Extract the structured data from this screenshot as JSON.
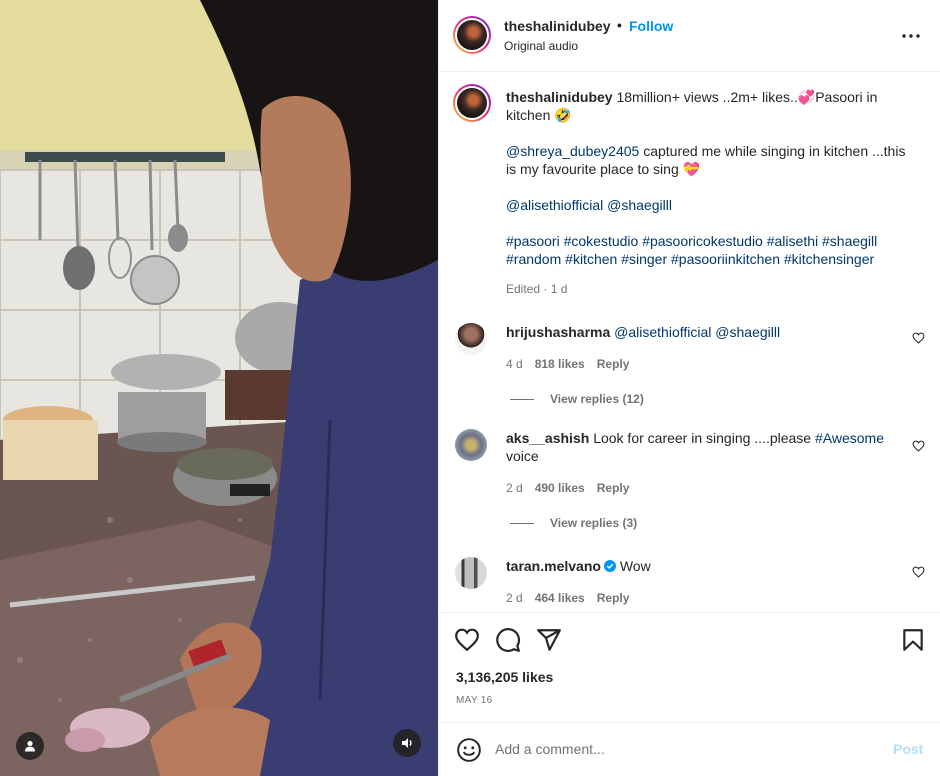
{
  "header": {
    "username": "theshalinidubey",
    "separator": "•",
    "follow_label": "Follow",
    "audio_label": "Original audio"
  },
  "caption": {
    "username": "theshalinidubey",
    "line1": "18million+ views ..2m+ likes..💞Pasoori in kitchen 🤣",
    "p2_mention": "@shreya_dubey2405",
    "p2_text": "captured me while singing in kitchen ...this is my favourite place to sing 💝",
    "p3_mention1": "@alisethiofficial",
    "p3_mention2": "@shaegilll",
    "hashtags": [
      "#pasoori",
      "#cokestudio",
      "#pasooricokestudio",
      "#alisethi",
      "#shaegill",
      "#random",
      "#kitchen",
      "#singer",
      "#pasooriinkitchen",
      "#kitchensinger"
    ],
    "meta": "Edited · 1 d"
  },
  "comments": [
    {
      "username": "hrijushasharma",
      "text_mention1": "@alisethiofficial",
      "text_mention2": "@shaegilll",
      "time": "4 d",
      "likes": "818 likes",
      "reply": "Reply",
      "view_replies": "View replies (12)"
    },
    {
      "username": "aks__ashish",
      "text": "Look for career in singing ....please",
      "text_tag": "#Awesome",
      "text_end": "voice",
      "time": "2 d",
      "likes": "490 likes",
      "reply": "Reply",
      "view_replies": "View replies (3)"
    },
    {
      "username": "taran.melvano",
      "verified": true,
      "text": "Wow",
      "time": "2 d",
      "likes": "464 likes",
      "reply": "Reply"
    }
  ],
  "actions": {
    "icons": [
      "heart-icon",
      "comment-icon",
      "share-icon",
      "bookmark-icon"
    ],
    "likes_count": "3,136,205 likes",
    "date": "MAY 16"
  },
  "add_comment": {
    "placeholder": "Add a comment...",
    "post_label": "Post"
  },
  "colors": {
    "link_blue": "#0095f6",
    "mention_blue": "#00376b",
    "muted": "#737373",
    "post_disabled": "#b2dffc"
  }
}
